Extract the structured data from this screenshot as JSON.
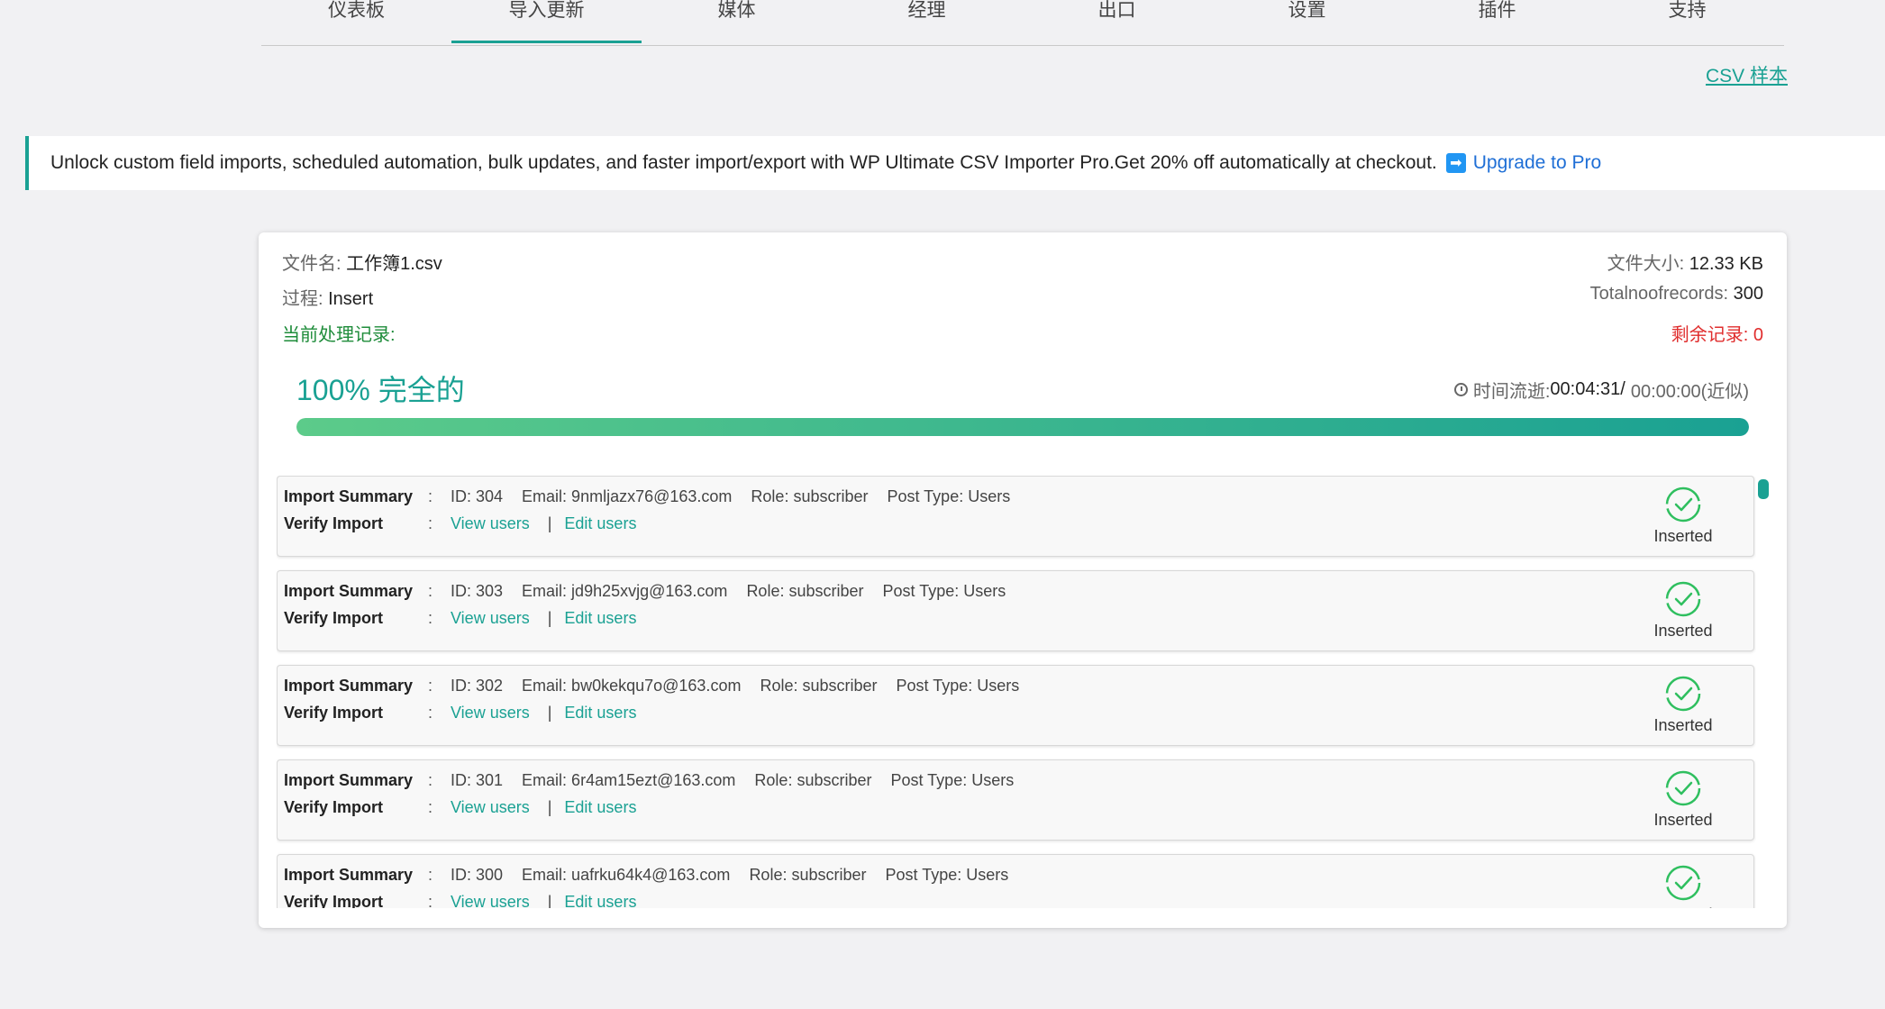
{
  "tabs": [
    {
      "label": "仪表板",
      "active": false
    },
    {
      "label": "导入更新",
      "active": true
    },
    {
      "label": "媒体",
      "active": false
    },
    {
      "label": "经理",
      "active": false
    },
    {
      "label": "出口",
      "active": false
    },
    {
      "label": "设置",
      "active": false
    },
    {
      "label": "插件",
      "active": false
    },
    {
      "label": "支持",
      "active": false
    }
  ],
  "csv_sample_link": "CSV 样本",
  "notice": {
    "text": "Unlock custom field imports, scheduled automation, bulk updates, and faster import/export with WP Ultimate CSV Importer Pro.Get 20% off automatically at checkout.",
    "arrow_icon": "➡",
    "upgrade_label": "Upgrade to Pro"
  },
  "file": {
    "name_label": "文件名:",
    "name": "工作簿1.csv",
    "size_label": "文件大小:",
    "size": "12.33 KB",
    "process_label": "过程:",
    "process": "Insert",
    "total_label": "Totalnoofrecords:",
    "total": "300",
    "current_label": "当前处理记录:",
    "remaining_label": "剩余记录:",
    "remaining": "0"
  },
  "progress": {
    "percent_text": "100% 完全的",
    "value": 100,
    "elapsed_label": "时间流逝:",
    "elapsed": "00:04:31/",
    "estimate": "00:00:00(近似)"
  },
  "colors": {
    "accent": "#1aa193",
    "success": "#2fbf5f",
    "danger": "#e02d2d"
  },
  "log_labels": {
    "summary": "Import Summary",
    "verify": "Verify Import",
    "colon": ":",
    "view": "View users",
    "edit": "Edit users",
    "sep": "|",
    "status_icon": "check-circle-icon"
  },
  "entries": [
    {
      "id": "ID: 304",
      "email": "Email: 9nmljazx76@163.com",
      "role": "Role: subscriber",
      "post_type": "Post Type: Users",
      "status": "Inserted"
    },
    {
      "id": "ID: 303",
      "email": "Email: jd9h25xvjg@163.com",
      "role": "Role: subscriber",
      "post_type": "Post Type: Users",
      "status": "Inserted"
    },
    {
      "id": "ID: 302",
      "email": "Email: bw0kekqu7o@163.com",
      "role": "Role: subscriber",
      "post_type": "Post Type: Users",
      "status": "Inserted"
    },
    {
      "id": "ID: 301",
      "email": "Email: 6r4am15ezt@163.com",
      "role": "Role: subscriber",
      "post_type": "Post Type: Users",
      "status": "Inserted"
    },
    {
      "id": "ID: 300",
      "email": "Email: uafrku64k4@163.com",
      "role": "Role: subscriber",
      "post_type": "Post Type: Users",
      "status": "Inserted"
    }
  ]
}
